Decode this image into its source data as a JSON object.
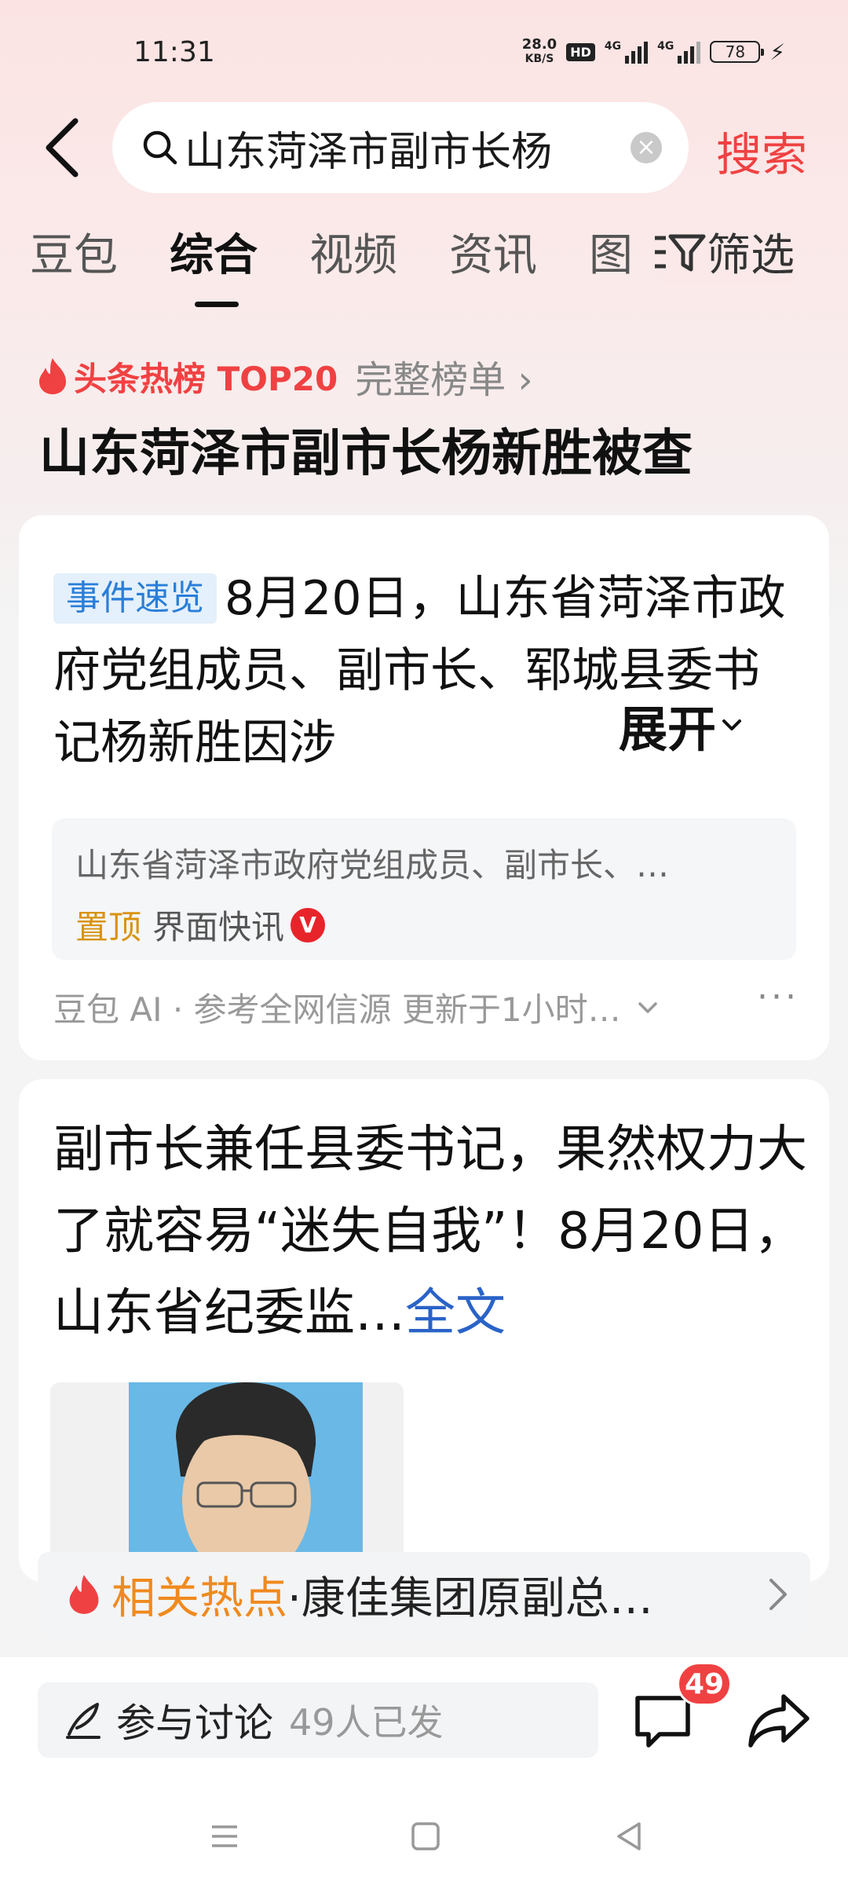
{
  "status_bar": {
    "time": "11:31",
    "net_speed_value": "28.0",
    "net_speed_unit": "KB/S",
    "hd_badge": "HD",
    "signal_1_label": "4G",
    "signal_2_label": "4G",
    "battery": "78"
  },
  "search": {
    "query": "山东菏泽市副市长杨",
    "submit_label": "搜索"
  },
  "tabs": [
    {
      "label": "豆包"
    },
    {
      "label": "综合",
      "active": true
    },
    {
      "label": "视频"
    },
    {
      "label": "资讯"
    },
    {
      "label": "图"
    }
  ],
  "filter_label": "筛选",
  "hot_list": {
    "label": "头条热榜 TOP20",
    "more_label": "完整榜单 ›",
    "headline": "山东菏泽市副市长杨新胜被查"
  },
  "event_card": {
    "tag": "事件速览",
    "summary": "8月20日，山东省菏泽市政府党组成员、副市长、郓城县委书记杨新胜因涉",
    "expand_label": "展开",
    "source_title": "山东省菏泽市政府党组成员、副市长、…",
    "source_pin": "置顶",
    "source_name": "界面快讯",
    "source_badge": "V",
    "ai_footer": "豆包 AI · 参考全网信源 更新于1小时…"
  },
  "article_card": {
    "text": "副市长兼任县委书记，果然权力大了就容易“迷失自我”！8月20日，山东省纪委监…",
    "fulltext_label": "全文"
  },
  "related_hot": {
    "label": "相关热点",
    "text": "·康佳集团原副总…"
  },
  "bottom_bar": {
    "discuss_label": "参与讨论",
    "discuss_count": "49人已发",
    "comment_count": "49"
  },
  "colors": {
    "accent_red": "#f04142",
    "link_blue": "#2a63c8",
    "tag_blue": "#2a7ed8",
    "related_orange": "#f08a1e",
    "pin_gold": "#d9930f"
  }
}
